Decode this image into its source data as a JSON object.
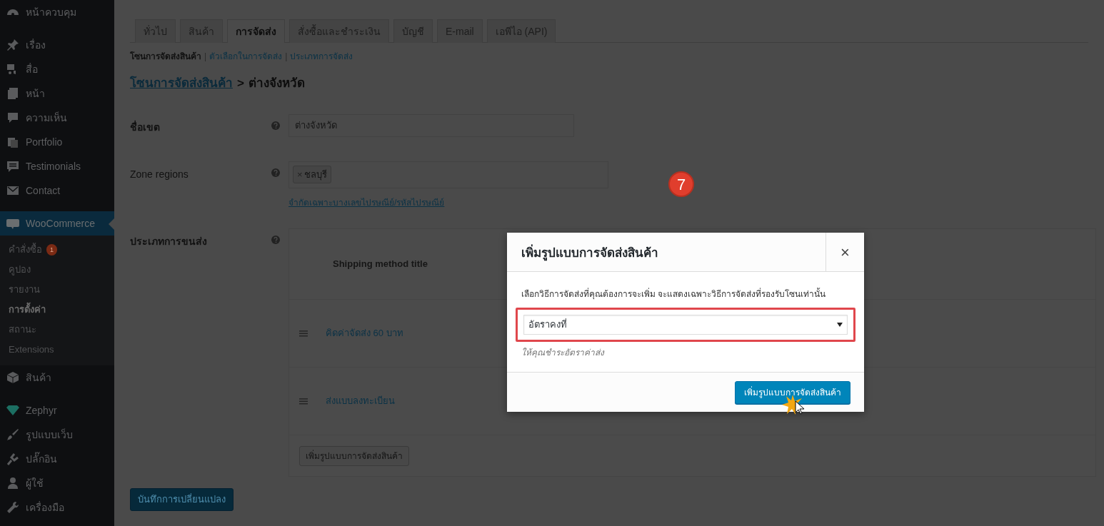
{
  "sidebar": {
    "items": [
      {
        "label": "หน้าควบคุม",
        "selected": false
      },
      {
        "label": "เรื่อง",
        "selected": false
      },
      {
        "label": "สื่อ",
        "selected": false
      },
      {
        "label": "หน้า",
        "selected": false
      },
      {
        "label": "ความเห็น",
        "selected": false
      },
      {
        "label": "Portfolio",
        "selected": false
      },
      {
        "label": "Testimonials",
        "selected": false
      },
      {
        "label": "Contact",
        "selected": false
      },
      {
        "label": "WooCommerce",
        "selected": true,
        "children": [
          {
            "label": "คำสั่งซื้อ",
            "selected": false,
            "badge": "1"
          },
          {
            "label": "คูปอง",
            "selected": false
          },
          {
            "label": "รายงาน",
            "selected": false
          },
          {
            "label": "การตั้งค่า",
            "selected": true
          },
          {
            "label": "สถานะ",
            "selected": false
          },
          {
            "label": "Extensions",
            "selected": false
          }
        ]
      },
      {
        "label": "สินค้า",
        "selected": false
      },
      {
        "label": "Zephyr",
        "selected": false
      },
      {
        "label": "รูปแบบเว็บ",
        "selected": false
      },
      {
        "label": "ปลั๊กอิน",
        "selected": false
      },
      {
        "label": "ผู้ใช้",
        "selected": false
      },
      {
        "label": "เครื่องมือ",
        "selected": false
      }
    ]
  },
  "tabs": [
    {
      "label": "ทั่วไป",
      "selected": false
    },
    {
      "label": "สินค้า",
      "selected": false
    },
    {
      "label": "การจัดส่ง",
      "selected": true
    },
    {
      "label": "สั่งซื้อและชำระเงิน",
      "selected": false
    },
    {
      "label": "บัญชี",
      "selected": false
    },
    {
      "label": "E-mail",
      "selected": false
    },
    {
      "label": "เอพีไอ (API)",
      "selected": false
    }
  ],
  "subnav_separator": "|",
  "subnav": [
    {
      "label": "โซนการจัดส่งสินค้า",
      "selected": true
    },
    {
      "label": "ตัวเลือกในการจัดส่ง",
      "selected": false
    },
    {
      "label": "ประเภทการจัดส่ง",
      "selected": false
    }
  ],
  "breadcrumb": {
    "link": "โซนการจัดส่งสินค้า",
    "separator": ">",
    "current": "ต่างจังหวัด"
  },
  "form": {
    "zone_name": {
      "label": "ชื่อเขต",
      "value": "ต่างจังหวัด"
    },
    "zone_regions": {
      "label": "Zone regions",
      "chips": [
        {
          "remove": "×",
          "label": "ชลบุรี"
        }
      ],
      "link": "จำกัดเฉพาะบางเลขไปรษณีย์/รหัสไปรษณีย์"
    },
    "shipping_methods": {
      "label": "ประเภทการขนส่ง",
      "column": "Shipping method title",
      "rows": [
        "คิดค่าจัดส่ง 60 บาท",
        "ส่งแบบลงทะเบียน"
      ],
      "add_button": "เพิ่มรูปแบบการจัดส่งสินค้า"
    }
  },
  "save_button": "บันทึกการเปลี่ยนแปลง",
  "step_badge": "7",
  "modal": {
    "title": "เพิ่มรูปแบบการจัดส่งสินค้า",
    "close": "×",
    "description": "เลือกวิธีการจัดส่งที่คุณต้องการจะเพิ่ม จะแสดงเฉพาะวิธีการจัดส่งที่รองรับโซนเท่านั้น",
    "select": {
      "value": "อัตราคงที่",
      "highlighted": true
    },
    "hint": "ให้คุณชำระอัตราค่าส่ง",
    "button": "เพิ่มรูปแบบการจัดส่งสินค้า"
  }
}
